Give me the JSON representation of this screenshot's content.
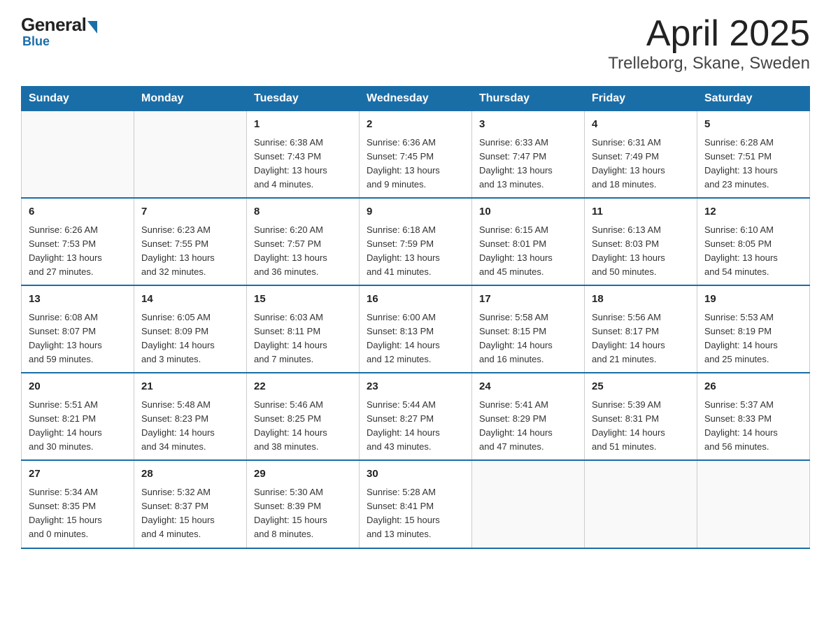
{
  "header": {
    "logo_general": "General",
    "logo_blue": "Blue",
    "title": "April 2025",
    "subtitle": "Trelleborg, Skane, Sweden"
  },
  "days_of_week": [
    "Sunday",
    "Monday",
    "Tuesday",
    "Wednesday",
    "Thursday",
    "Friday",
    "Saturday"
  ],
  "weeks": [
    [
      {
        "day": "",
        "info": ""
      },
      {
        "day": "",
        "info": ""
      },
      {
        "day": "1",
        "info": "Sunrise: 6:38 AM\nSunset: 7:43 PM\nDaylight: 13 hours\nand 4 minutes."
      },
      {
        "day": "2",
        "info": "Sunrise: 6:36 AM\nSunset: 7:45 PM\nDaylight: 13 hours\nand 9 minutes."
      },
      {
        "day": "3",
        "info": "Sunrise: 6:33 AM\nSunset: 7:47 PM\nDaylight: 13 hours\nand 13 minutes."
      },
      {
        "day": "4",
        "info": "Sunrise: 6:31 AM\nSunset: 7:49 PM\nDaylight: 13 hours\nand 18 minutes."
      },
      {
        "day": "5",
        "info": "Sunrise: 6:28 AM\nSunset: 7:51 PM\nDaylight: 13 hours\nand 23 minutes."
      }
    ],
    [
      {
        "day": "6",
        "info": "Sunrise: 6:26 AM\nSunset: 7:53 PM\nDaylight: 13 hours\nand 27 minutes."
      },
      {
        "day": "7",
        "info": "Sunrise: 6:23 AM\nSunset: 7:55 PM\nDaylight: 13 hours\nand 32 minutes."
      },
      {
        "day": "8",
        "info": "Sunrise: 6:20 AM\nSunset: 7:57 PM\nDaylight: 13 hours\nand 36 minutes."
      },
      {
        "day": "9",
        "info": "Sunrise: 6:18 AM\nSunset: 7:59 PM\nDaylight: 13 hours\nand 41 minutes."
      },
      {
        "day": "10",
        "info": "Sunrise: 6:15 AM\nSunset: 8:01 PM\nDaylight: 13 hours\nand 45 minutes."
      },
      {
        "day": "11",
        "info": "Sunrise: 6:13 AM\nSunset: 8:03 PM\nDaylight: 13 hours\nand 50 minutes."
      },
      {
        "day": "12",
        "info": "Sunrise: 6:10 AM\nSunset: 8:05 PM\nDaylight: 13 hours\nand 54 minutes."
      }
    ],
    [
      {
        "day": "13",
        "info": "Sunrise: 6:08 AM\nSunset: 8:07 PM\nDaylight: 13 hours\nand 59 minutes."
      },
      {
        "day": "14",
        "info": "Sunrise: 6:05 AM\nSunset: 8:09 PM\nDaylight: 14 hours\nand 3 minutes."
      },
      {
        "day": "15",
        "info": "Sunrise: 6:03 AM\nSunset: 8:11 PM\nDaylight: 14 hours\nand 7 minutes."
      },
      {
        "day": "16",
        "info": "Sunrise: 6:00 AM\nSunset: 8:13 PM\nDaylight: 14 hours\nand 12 minutes."
      },
      {
        "day": "17",
        "info": "Sunrise: 5:58 AM\nSunset: 8:15 PM\nDaylight: 14 hours\nand 16 minutes."
      },
      {
        "day": "18",
        "info": "Sunrise: 5:56 AM\nSunset: 8:17 PM\nDaylight: 14 hours\nand 21 minutes."
      },
      {
        "day": "19",
        "info": "Sunrise: 5:53 AM\nSunset: 8:19 PM\nDaylight: 14 hours\nand 25 minutes."
      }
    ],
    [
      {
        "day": "20",
        "info": "Sunrise: 5:51 AM\nSunset: 8:21 PM\nDaylight: 14 hours\nand 30 minutes."
      },
      {
        "day": "21",
        "info": "Sunrise: 5:48 AM\nSunset: 8:23 PM\nDaylight: 14 hours\nand 34 minutes."
      },
      {
        "day": "22",
        "info": "Sunrise: 5:46 AM\nSunset: 8:25 PM\nDaylight: 14 hours\nand 38 minutes."
      },
      {
        "day": "23",
        "info": "Sunrise: 5:44 AM\nSunset: 8:27 PM\nDaylight: 14 hours\nand 43 minutes."
      },
      {
        "day": "24",
        "info": "Sunrise: 5:41 AM\nSunset: 8:29 PM\nDaylight: 14 hours\nand 47 minutes."
      },
      {
        "day": "25",
        "info": "Sunrise: 5:39 AM\nSunset: 8:31 PM\nDaylight: 14 hours\nand 51 minutes."
      },
      {
        "day": "26",
        "info": "Sunrise: 5:37 AM\nSunset: 8:33 PM\nDaylight: 14 hours\nand 56 minutes."
      }
    ],
    [
      {
        "day": "27",
        "info": "Sunrise: 5:34 AM\nSunset: 8:35 PM\nDaylight: 15 hours\nand 0 minutes."
      },
      {
        "day": "28",
        "info": "Sunrise: 5:32 AM\nSunset: 8:37 PM\nDaylight: 15 hours\nand 4 minutes."
      },
      {
        "day": "29",
        "info": "Sunrise: 5:30 AM\nSunset: 8:39 PM\nDaylight: 15 hours\nand 8 minutes."
      },
      {
        "day": "30",
        "info": "Sunrise: 5:28 AM\nSunset: 8:41 PM\nDaylight: 15 hours\nand 13 minutes."
      },
      {
        "day": "",
        "info": ""
      },
      {
        "day": "",
        "info": ""
      },
      {
        "day": "",
        "info": ""
      }
    ]
  ]
}
